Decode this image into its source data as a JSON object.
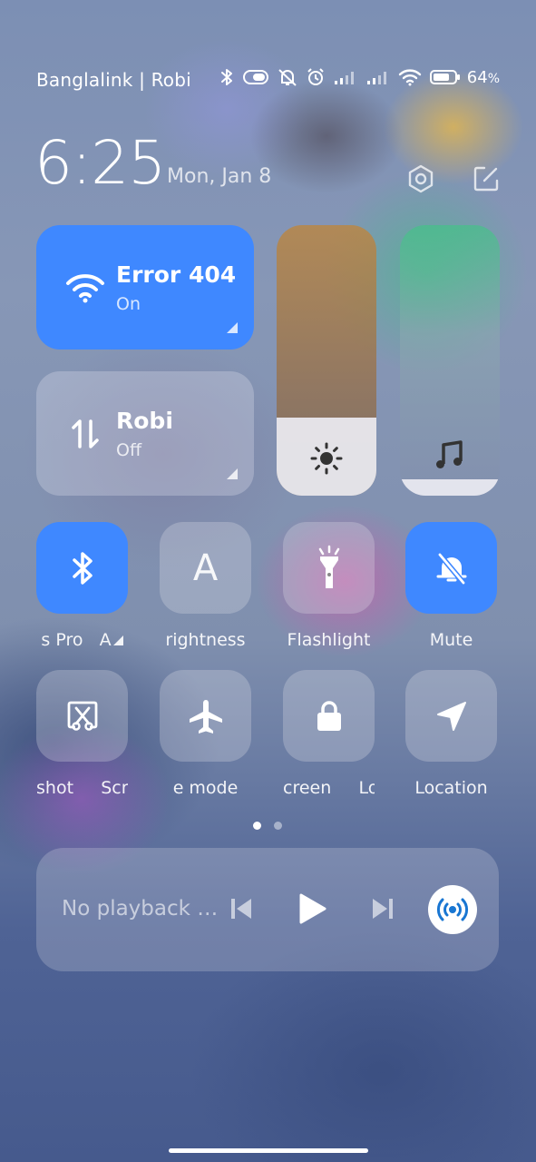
{
  "status_bar": {
    "carrier": "Banglalink | Robi",
    "battery_percent": "64",
    "battery_symbol": "%",
    "icons": [
      "bluetooth-icon",
      "toggle-icon",
      "vibrate-off-icon",
      "alarm-icon",
      "signal-icon",
      "signal-icon",
      "wifi-icon",
      "battery-icon"
    ]
  },
  "header": {
    "time": "6:25",
    "date": "Mon, Jan 8",
    "settings_icon": "settings-icon",
    "edit_icon": "edit-icon"
  },
  "tiles": {
    "wifi": {
      "title": "Error 404",
      "state": "On",
      "color": "#3f88ff"
    },
    "mobile_data": {
      "title": "Robi",
      "state": "Off"
    }
  },
  "sliders": {
    "brightness_level": 0.29,
    "volume_level": 0.06
  },
  "toggles_row1": [
    {
      "label": "s Pro",
      "label2": "A",
      "active": true,
      "icon": "bluetooth-icon"
    },
    {
      "label": "rightness",
      "active": false,
      "icon": "letter-a-icon",
      "glyph": "A"
    },
    {
      "label": "Flashlight",
      "active": false,
      "icon": "flashlight-icon"
    },
    {
      "label": "Mute",
      "active": true,
      "icon": "mute-bell-icon"
    }
  ],
  "toggles_row2": [
    {
      "label": "shot",
      "label2": "Scr",
      "active": false,
      "icon": "screenshot-icon"
    },
    {
      "label": "e mode",
      "active": false,
      "icon": "airplane-icon"
    },
    {
      "label": "creen",
      "label2": "Lo",
      "active": false,
      "icon": "lock-icon"
    },
    {
      "label": "Location",
      "active": false,
      "icon": "location-icon"
    }
  ],
  "pager": {
    "pages": 2,
    "current": 1
  },
  "media": {
    "text": "No playback …",
    "accent": "#1976d2"
  }
}
